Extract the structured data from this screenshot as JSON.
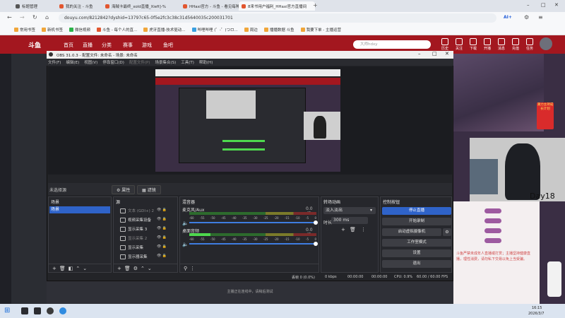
{
  "browser": {
    "tabs": [
      {
        "label": "标题管理"
      },
      {
        "label": "我的关注 - 斗鱼"
      },
      {
        "label": "海贼卡最终_xold直播_Xiefi]-%"
      },
      {
        "label": "HHaxi官方 - 斗鱼 - 看见每种热爱"
      },
      {
        "label": "8来书用户福利_HHaxi官方直播间"
      }
    ],
    "url": "douyu.com/8212842?dyshid=13797c65-0f5e2fc3c38c31d5640035c200031701",
    "ai_label": "AI+",
    "bookmarks": [
      "常用书签",
      "新机书签",
      "微信视频",
      "斗鱼 - 每个人的直...",
      "虎牙直播-技术驱动...",
      "哔哩哔哩 (゜-゜)つロ...",
      "周边",
      "播播数据 斗鱼",
      "我要下单 - 主播运营"
    ]
  },
  "douyu": {
    "logo": "斗鱼",
    "nav": [
      "首页",
      "直播",
      "分类",
      "赛事",
      "游戏",
      "鱼吧"
    ],
    "search_placeholder": "大师hdxy",
    "top_icons": [
      "历史",
      "关注",
      "下载",
      "开播",
      "消息",
      "充值",
      "任务"
    ],
    "promo": "潮力主持成长计划",
    "streamer_tag": "Day18",
    "chat_notice": "斗鱼严禁未成年人直播或打赏；主播坚持健康直播，理性消费，请勿私下交易以免上当受骗。",
    "below_obs": "主播正在连线中，请稍后测试"
  },
  "obs": {
    "title": "OBS 31.0.3 - 配置文件: 未命名 - 场景: 未命名",
    "menu": [
      "文件(F)",
      "编辑(E)",
      "视图(V)",
      "停靠窗口(D)",
      "配置文件(P)",
      "场景集合(S)",
      "工具(T)",
      "帮助(H)"
    ],
    "scene_label": "未选择源",
    "scene_buttons": [
      "属性",
      "滤镜"
    ],
    "panels": {
      "scenes": {
        "title": "场景",
        "items": [
          "场景"
        ]
      },
      "sources": {
        "title": "源",
        "items": [
          "文本 (GDI+) 2",
          "视频采集设备",
          "显示采集 3",
          "显示采集 2",
          "显示采集",
          "显示器采集"
        ]
      },
      "mixer": {
        "title": "混音器",
        "tracks": [
          {
            "name": "麦克风/Aux",
            "db": "0.0 dB"
          },
          {
            "name": "桌面音频",
            "db": "0.0 dB"
          }
        ],
        "scale": [
          "-60",
          "-55",
          "-50",
          "-45",
          "-40",
          "-35",
          "-30",
          "-25",
          "-20",
          "-15",
          "-10",
          "-5",
          "0"
        ]
      },
      "transitions": {
        "title": "转场动画",
        "type": "淡入淡出",
        "duration_label": "时长",
        "duration": "300 ms"
      },
      "controls": {
        "title": "控制按钮",
        "buttons": [
          "停止直播",
          "开始录制",
          "启动虚拟摄像机",
          "工作室模式",
          "设置",
          "退出"
        ]
      }
    },
    "status": {
      "dropped": "丢帧 0 (0.0%)",
      "kbps": "0 kbps",
      "time1": "00:00:00",
      "time2": "00:00:00",
      "cpu": "CPU: 0.9%",
      "fps": "60.00 / 60.00 FPS"
    }
  },
  "taskbar": {
    "time": "16:15",
    "date": "2026/3/7"
  }
}
